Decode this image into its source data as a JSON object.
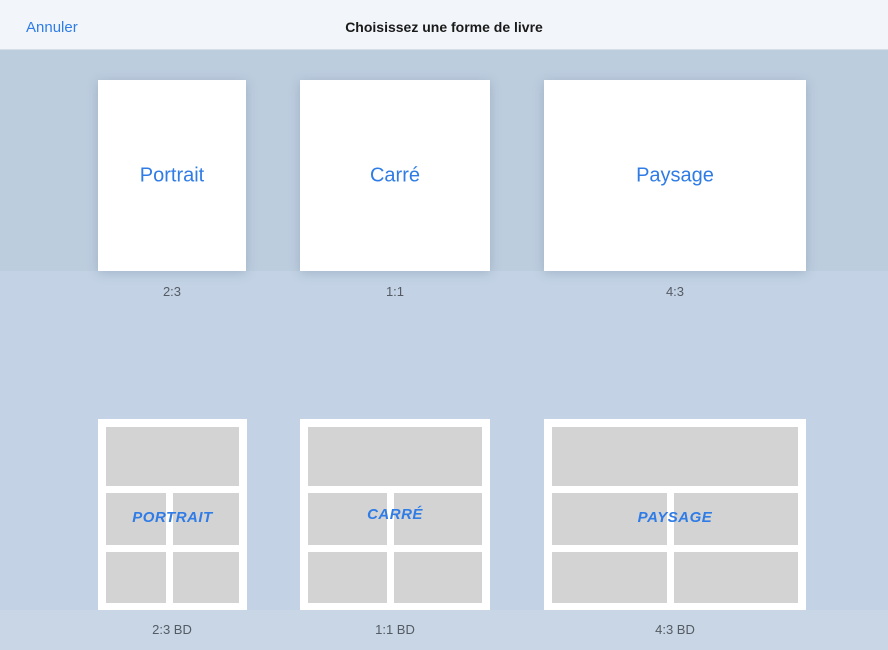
{
  "navbar": {
    "cancel_label": "Annuler",
    "title": "Choisissez une forme de livre"
  },
  "books": [
    {
      "label": "Portrait",
      "ratio": "2:3"
    },
    {
      "label": "Carré",
      "ratio": "1:1"
    },
    {
      "label": "Paysage",
      "ratio": "4:3"
    }
  ],
  "comics": [
    {
      "label": "PORTRAIT",
      "ratio": "2:3 BD"
    },
    {
      "label": "CARRÉ",
      "ratio": "1:1 BD"
    },
    {
      "label": "PAYSAGE",
      "ratio": "4:3 BD"
    }
  ],
  "colors": {
    "accent": "#2f7ce6",
    "panel": "#d3d3d3",
    "background": "#c3d3e5"
  }
}
